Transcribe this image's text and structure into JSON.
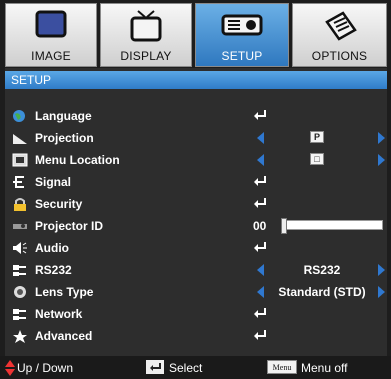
{
  "tabs": [
    {
      "label": "IMAGE",
      "icon": "monitor-icon",
      "active": false
    },
    {
      "label": "DISPLAY",
      "icon": "tv-icon",
      "active": false
    },
    {
      "label": "SETUP",
      "icon": "projector-icon",
      "active": true
    },
    {
      "label": "OPTIONS",
      "icon": "document-pen-icon",
      "active": false
    }
  ],
  "panel": {
    "title": "SETUP"
  },
  "menu": [
    {
      "label": "Language",
      "icon": "globe-icon",
      "control": "enter"
    },
    {
      "label": "Projection",
      "icon": "wedge-icon",
      "control": "select-icon",
      "value": "P"
    },
    {
      "label": "Menu Location",
      "icon": "menu-location-icon",
      "control": "select-icon",
      "value": "□"
    },
    {
      "label": "Signal",
      "icon": "signal-icon",
      "control": "enter"
    },
    {
      "label": "Security",
      "icon": "lock-icon",
      "control": "enter"
    },
    {
      "label": "Projector ID",
      "icon": "projector-id-icon",
      "control": "slider",
      "value": "00",
      "level": 0
    },
    {
      "label": "Audio",
      "icon": "speaker-icon",
      "control": "enter"
    },
    {
      "label": "RS232",
      "icon": "rs232-icon",
      "control": "select",
      "value": "RS232"
    },
    {
      "label": "Lens Type",
      "icon": "lens-icon",
      "control": "select",
      "value": "Standard (STD)"
    },
    {
      "label": "Network",
      "icon": "network-icon",
      "control": "enter"
    },
    {
      "label": "Advanced",
      "icon": "star-icon",
      "control": "enter"
    }
  ],
  "status": {
    "updown": "Up / Down",
    "select": "Select",
    "menu_key": "Menu",
    "menu_off": "Menu off"
  },
  "colors": {
    "accent": "#2f78d0",
    "tab_active": "#3a86d0"
  }
}
